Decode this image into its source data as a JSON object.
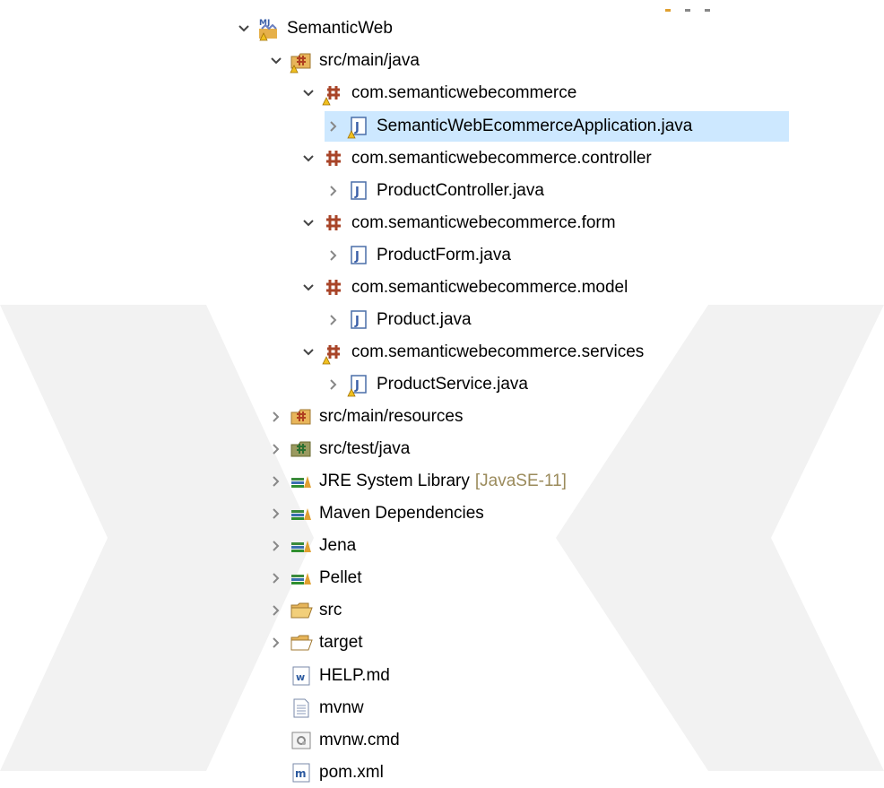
{
  "project_explorer": {
    "items": [
      {
        "label": "SemanticWeb",
        "icon": "maven-project-icon",
        "expanded": true,
        "level": 0
      },
      {
        "label": "src/main/java",
        "icon": "source-folder-warning-icon",
        "expanded": true,
        "level": 1
      },
      {
        "label": "com.semanticwebecommerce",
        "icon": "package-warning-icon",
        "expanded": true,
        "level": 2
      },
      {
        "label": "SemanticWebEcommerceApplication.java",
        "icon": "java-file-warning-icon",
        "expanded": false,
        "level": 3,
        "selected": true
      },
      {
        "label": "com.semanticwebecommerce.controller",
        "icon": "package-icon",
        "expanded": true,
        "level": 2
      },
      {
        "label": "ProductController.java",
        "icon": "java-file-icon",
        "expanded": false,
        "level": 3
      },
      {
        "label": "com.semanticwebecommerce.form",
        "icon": "package-icon",
        "expanded": true,
        "level": 2
      },
      {
        "label": "ProductForm.java",
        "icon": "java-file-icon",
        "expanded": false,
        "level": 3
      },
      {
        "label": "com.semanticwebecommerce.model",
        "icon": "package-icon",
        "expanded": true,
        "level": 2
      },
      {
        "label": "Product.java",
        "icon": "java-file-icon",
        "expanded": false,
        "level": 3
      },
      {
        "label": "com.semanticwebecommerce.services",
        "icon": "package-warning-icon",
        "expanded": true,
        "level": 2
      },
      {
        "label": "ProductService.java",
        "icon": "java-file-warning-icon",
        "expanded": false,
        "level": 3
      },
      {
        "label": "src/main/resources",
        "icon": "source-folder-icon",
        "expanded": false,
        "level": 1
      },
      {
        "label": "src/test/java",
        "icon": "test-source-folder-icon",
        "expanded": false,
        "level": 1
      },
      {
        "label": "JRE System Library",
        "decoration": "[JavaSE-11]",
        "icon": "library-icon",
        "expanded": false,
        "level": 1
      },
      {
        "label": "Maven Dependencies",
        "icon": "library-icon",
        "expanded": false,
        "level": 1
      },
      {
        "label": "Jena",
        "icon": "library-icon",
        "expanded": false,
        "level": 1
      },
      {
        "label": "Pellet",
        "icon": "library-icon",
        "expanded": false,
        "level": 1
      },
      {
        "label": "src",
        "icon": "folder-open-icon",
        "expanded": false,
        "level": 1
      },
      {
        "label": "target",
        "icon": "folder-icon",
        "expanded": false,
        "level": 1
      },
      {
        "label": "HELP.md",
        "icon": "word-file-icon",
        "level": 1,
        "leaf": true
      },
      {
        "label": "mvnw",
        "icon": "text-file-icon",
        "level": 1,
        "leaf": true
      },
      {
        "label": "mvnw.cmd",
        "icon": "cmd-file-icon",
        "level": 1,
        "leaf": true
      },
      {
        "label": "pom.xml",
        "icon": "maven-pom-icon",
        "level": 1,
        "leaf": true
      }
    ]
  },
  "colors": {
    "selection": "#cde8ff",
    "decoration": "#9b8b5c",
    "watermark": "#f1f1f1"
  }
}
